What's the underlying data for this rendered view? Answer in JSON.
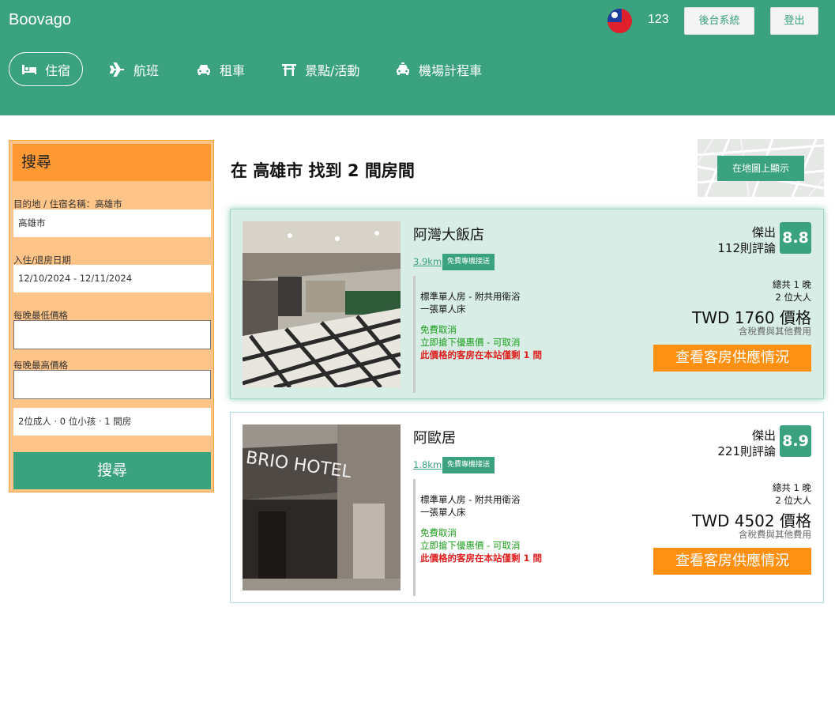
{
  "header": {
    "brand": "Boovago",
    "user_id": "123",
    "admin_button": "後台系統",
    "logout_button": "登出"
  },
  "nav": [
    {
      "label": "住宿",
      "icon": "bed-icon",
      "active": true
    },
    {
      "label": "航班",
      "icon": "plane-icon"
    },
    {
      "label": "租車",
      "icon": "car-icon"
    },
    {
      "label": "景點/活動",
      "icon": "torii-gate-icon"
    },
    {
      "label": "機場計程車",
      "icon": "taxi-icon"
    }
  ],
  "search": {
    "title": "搜尋",
    "destination_label": "目的地 / 住宿名稱：高雄市",
    "destination_value": "高雄市",
    "dates_label": "入住/退房日期",
    "dates_value": "12/10/2024 - 12/11/2024",
    "min_price_label": "每晚最低價格",
    "min_price_value": "",
    "max_price_label": "每晚最高價格",
    "max_price_value": "",
    "guests_value": "2位成人 · 0 位小孩 · 1 間房",
    "submit_label": "搜尋"
  },
  "results": {
    "title": "在 高雄市 找到 2 間房間",
    "map_button": "在地圖上顯示"
  },
  "hotels": [
    {
      "name": "阿灣大飯店",
      "distance": "3.9km",
      "shuttle": "免費專機接送",
      "room_type": "標準單人房 - 附共用衛浴",
      "bed": "一張單人床",
      "free_cancel": "免費取消",
      "deal": "立即搶下優惠價 - 可取消",
      "scarcity": "此價格的客房在本站僅剩 1 間",
      "rating_word": "傑出",
      "reviews": "112則評論",
      "score": "8.8",
      "nights": "總共 1 晚",
      "guests": "2 位大人",
      "price": "TWD 1760 價格",
      "taxes": "含稅費與其他費用",
      "cta": "查看客房供應情況"
    },
    {
      "name": "阿歐居",
      "distance": "1.8km",
      "shuttle": "免費專機接送",
      "room_type": "標準單人房 - 附共用衛浴",
      "bed": "一張單人床",
      "free_cancel": "免費取消",
      "deal": "立即搶下優惠價 - 可取消",
      "scarcity": "此價格的客房在本站僅剩 1 間",
      "rating_word": "傑出",
      "reviews": "221則評論",
      "score": "8.9",
      "nights": "總共 1 晚",
      "guests": "2 位大人",
      "price": "TWD 4502 價格",
      "taxes": "含稅費與其他費用",
      "cta": "查看客房供應情況",
      "photo_sign": "BRIO HOTEL"
    }
  ],
  "colors": {
    "brand_green": "#3aa27f",
    "search_orange": "#ff9933",
    "cta_orange": "#ff9012"
  }
}
